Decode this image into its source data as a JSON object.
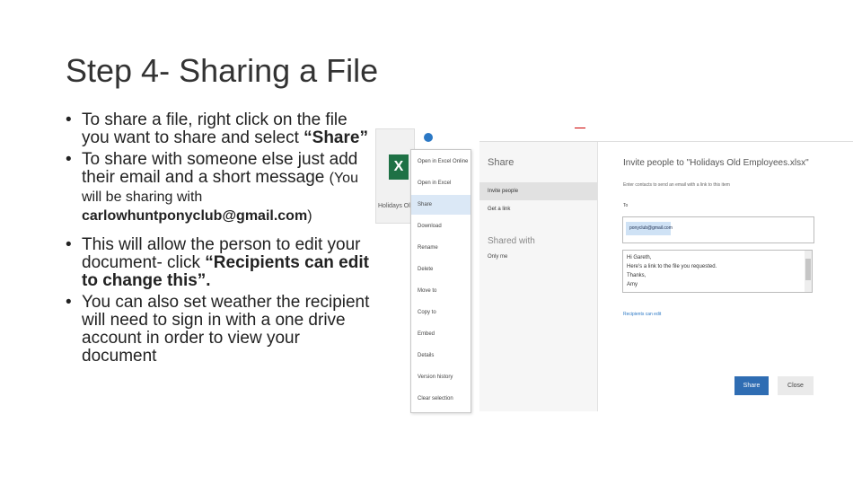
{
  "slide": {
    "title": "Step 4- Sharing a File",
    "bullets": {
      "b1_text": "To share a file, right click on the file you want to share and select ",
      "b1_bold": "“Share”",
      "b2_text": "To share with someone else  just add their email and a short message ",
      "b2_small": "(You will be sharing with ",
      "b2_email": "carlowhuntponyclub@gmail.com",
      "b2_close": ")",
      "b3_text": "This will allow the person to edit your document- click ",
      "b3_bold": "“Recipients can edit to change this”.",
      "b4_text": "You can also set weather the recipient will need to sign in with a one drive account in order to view your document"
    }
  },
  "screenshot": {
    "file_caption": "Holidays Old E",
    "file_icon": "excel-icon",
    "context_menu": [
      "Open in Excel Online",
      "Open in Excel",
      "Share",
      "Download",
      "Rename",
      "Delete",
      "Move to",
      "Copy to",
      "Embed",
      "Details",
      "Version history",
      "Clear selection"
    ],
    "share_panel": {
      "heading": "Share",
      "invite_people": "Invite people",
      "get_a_link": "Get a link",
      "shared_with": "Shared with",
      "only_me": "Only me",
      "invite_title": "Invite people to \"Holidays Old Employees.xlsx\"",
      "enter_contacts": "Enter contacts to send an email with a link to this item",
      "to_label": "To",
      "recipient_chip": "ponyclub@gmail.com",
      "message_lines": [
        "Hi Gareth,",
        "Here's a link to the file you requested.",
        "Thanks,",
        "Amy"
      ],
      "recipients_link": "Recipients can edit",
      "share_button": "Share",
      "close_button": "Close"
    },
    "colors": {
      "accent": "#2f6db3",
      "excel": "#1e7145",
      "selected": "#dbe8f6"
    }
  }
}
